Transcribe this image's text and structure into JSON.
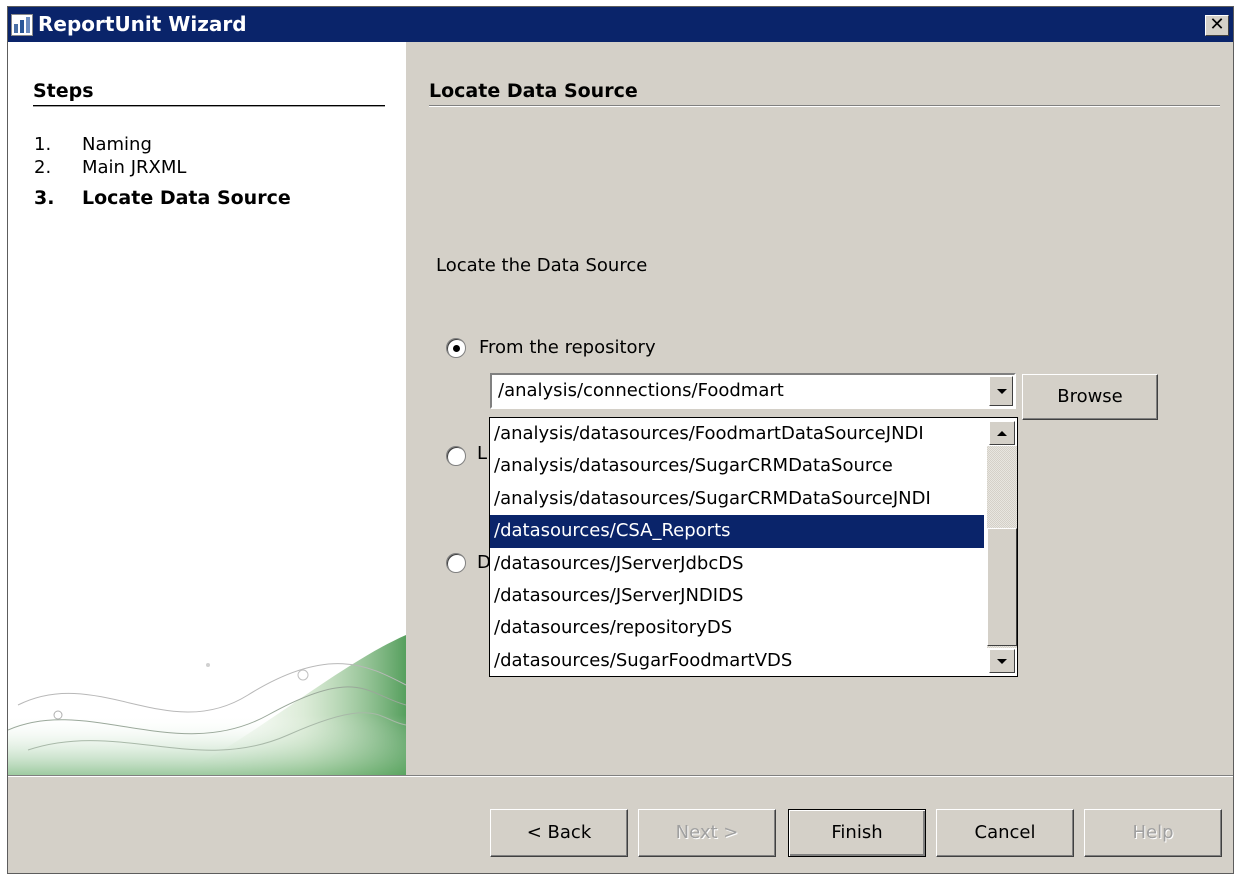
{
  "window": {
    "title": "ReportUnit Wizard",
    "close_label": "✕"
  },
  "steps_panel": {
    "title": "Steps",
    "steps": [
      {
        "number": "1.",
        "label": "Naming",
        "current": false
      },
      {
        "number": "2.",
        "label": "Main JRXML",
        "current": false
      },
      {
        "number": "3.",
        "label": "Locate Data Source",
        "current": true
      }
    ]
  },
  "main": {
    "title": "Locate Data Source",
    "instruction": "Locate the Data Source",
    "options": [
      {
        "label": "From the repository",
        "selected": true
      },
      {
        "label": "L",
        "selected": false
      },
      {
        "label": "D",
        "selected": false
      }
    ],
    "combo": {
      "value": "/analysis/connections/Foodmart",
      "browse_label": "Browse"
    },
    "dropdown": {
      "items": [
        "/analysis/datasources/FoodmartDataSourceJNDI",
        "/analysis/datasources/SugarCRMDataSource",
        "/analysis/datasources/SugarCRMDataSourceJNDI",
        "/datasources/CSA_Reports",
        "/datasources/JServerJdbcDS",
        "/datasources/JServerJNDIDS",
        "/datasources/repositoryDS",
        "/datasources/SugarFoodmartVDS"
      ],
      "selected_index": 3
    }
  },
  "buttons": {
    "back": "< Back",
    "next": "Next >",
    "finish": "Finish",
    "cancel": "Cancel",
    "help": "Help"
  }
}
